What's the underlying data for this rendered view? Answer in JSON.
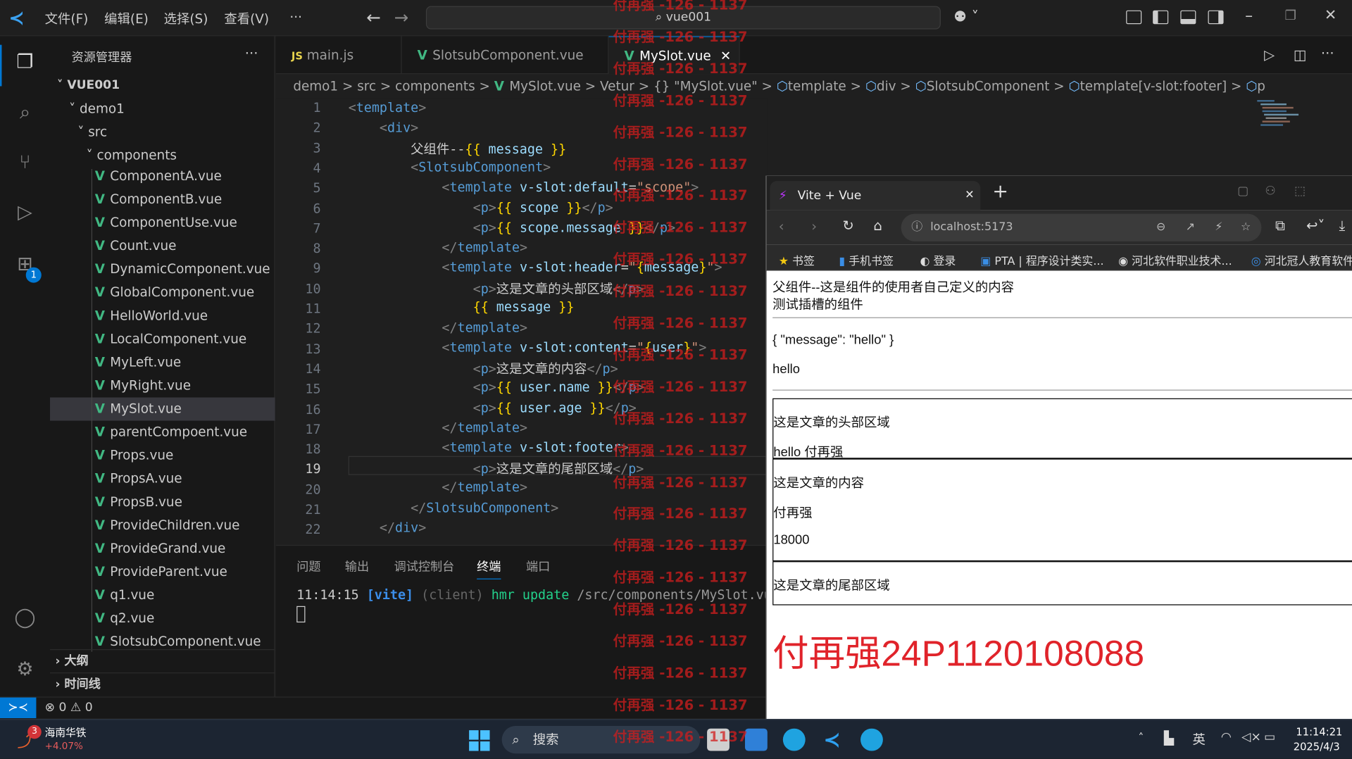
{
  "titlebar": {
    "menus": [
      "文件(F)",
      "编辑(E)",
      "选择(S)",
      "查看(V)",
      "···"
    ],
    "command_center": "vue001"
  },
  "sidebar": {
    "title": "资源管理器",
    "more": "···",
    "project": "VUE001",
    "folders": [
      "demo1",
      "src",
      "components"
    ],
    "files": [
      "ComponentA.vue",
      "ComponentB.vue",
      "ComponentUse.vue",
      "Count.vue",
      "DynamicComponent.vue",
      "GlobalComponent.vue",
      "HelloWorld.vue",
      "LocalComponent.vue",
      "MyLeft.vue",
      "MyRight.vue",
      "MySlot.vue",
      "parentCompoent.vue",
      "Props.vue",
      "PropsA.vue",
      "PropsB.vue",
      "ProvideChildren.vue",
      "ProvideGrand.vue",
      "ProvideParent.vue",
      "q1.vue",
      "q2.vue",
      "SlotsubComponent.vue"
    ],
    "outline": "大纲",
    "timeline": "时间线"
  },
  "tabs": [
    {
      "icon": "JS",
      "label": "main.js"
    },
    {
      "icon": "V",
      "label": "SlotsubComponent.vue"
    },
    {
      "icon": "V",
      "label": "MySlot.vue"
    }
  ],
  "breadcrumb": [
    "demo1",
    ">",
    "src",
    ">",
    "components",
    ">",
    "MySlot.vue",
    ">",
    "Vetur",
    ">",
    "{} \"MySlot.vue\"",
    ">",
    "template",
    ">",
    "div",
    ">",
    "SlotsubComponent",
    ">",
    "template[v-slot:footer]",
    ">",
    "p"
  ],
  "code": {
    "line_numbers": [
      "1",
      "2",
      "3",
      "4",
      "5",
      "6",
      "7",
      "8",
      "9",
      "10",
      "11",
      "12",
      "13",
      "14",
      "15",
      "16",
      "17",
      "18",
      "19",
      "20",
      "21",
      "22"
    ],
    "current_line": "19"
  },
  "panel": {
    "tabs": [
      "问题",
      "输出",
      "调试控制台",
      "终端",
      "端口"
    ],
    "log_time": "11:14:15",
    "log_tag": "[vite]",
    "log_client": "(client)",
    "log_msg": "hmr update",
    "log_path": "/src/components/MySlot.vu"
  },
  "status": {
    "errors": "0",
    "warnings": "0"
  },
  "activity": {
    "badge": "1"
  },
  "watermark": "付再强 -126 - 1137",
  "browser": {
    "tab_title": "Vite + Vue",
    "url": "localhost:5173",
    "bookmarks": [
      "书签",
      "手机书签",
      "登录",
      "PTA | 程序设计类实...",
      "河北软件职业技术...",
      "河北冠人教育软件"
    ],
    "content": {
      "line1": "父组件--这是组件的使用者自己定义的内容",
      "line2": "测试插槽的组件",
      "scope_json": "{ \"message\": \"hello\" }",
      "scope_msg": "hello",
      "header_text": "这是文章的头部区域",
      "header_msg": "hello 付再强",
      "content_text": "这是文章的内容",
      "user_name": "付再强",
      "user_age": "18000",
      "footer_text": "这是文章的尾部区域",
      "big_text": "付再强24P1120108088"
    }
  },
  "taskbar": {
    "stock_name": "海南华铁",
    "stock_change": "+4.07%",
    "stock_badge": "3",
    "search": "搜索",
    "ime": "英",
    "time": "11:14:21",
    "date": "2025/4/3"
  }
}
